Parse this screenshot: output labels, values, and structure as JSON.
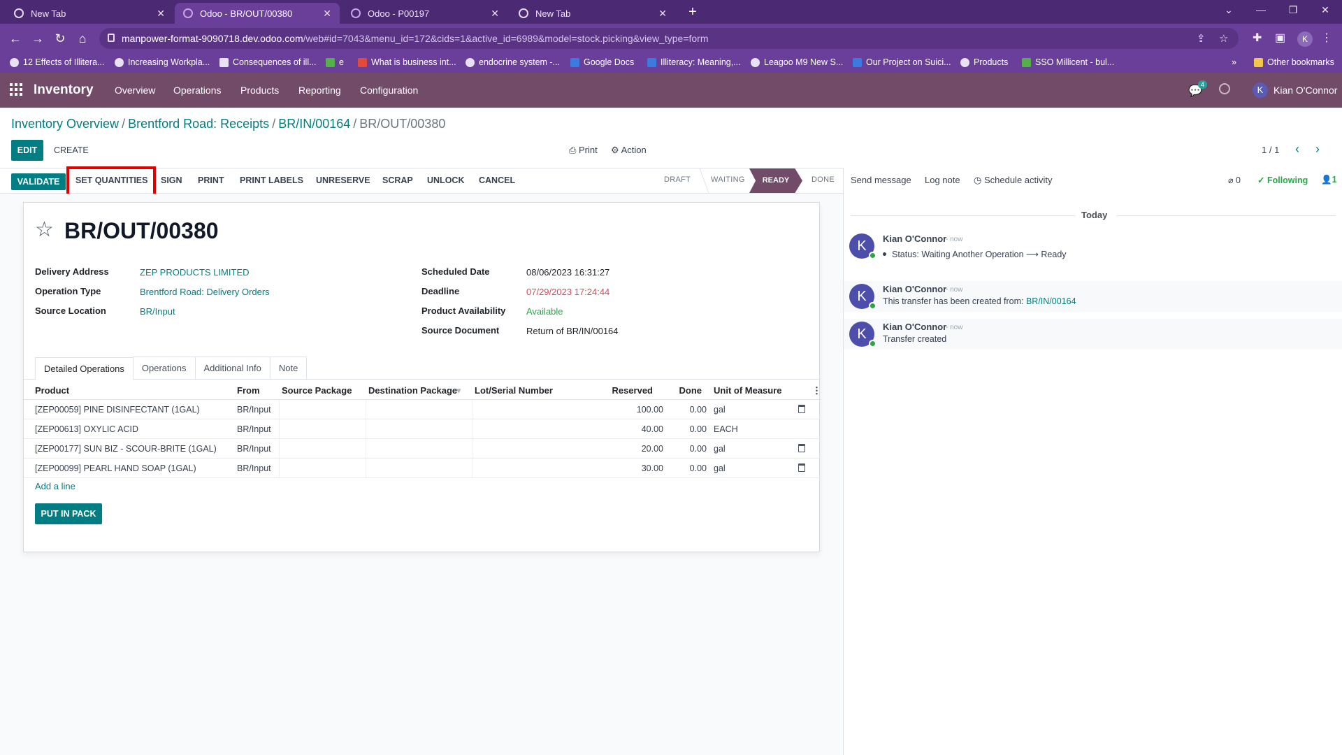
{
  "browser": {
    "tabs": [
      {
        "title": "New Tab",
        "active": false
      },
      {
        "title": "Odoo - BR/OUT/00380",
        "active": true
      },
      {
        "title": "Odoo - P00197",
        "active": false
      },
      {
        "title": "New Tab",
        "active": false
      }
    ],
    "url_host": "manpower-format-9090718.dev.odoo.com",
    "url_path": "/web#id=7043&menu_id=172&cids=1&active_id=6989&model=stock.picking&view_type=form",
    "bookmarks": [
      {
        "label": "12 Effects of Illitera...",
        "icon": "globe-icon"
      },
      {
        "label": "Increasing Workpla...",
        "icon": "globe-icon"
      },
      {
        "label": "Consequences of ill...",
        "icon": "site-icon"
      },
      {
        "label": "e",
        "icon": "drive-icon"
      },
      {
        "label": "What is business int...",
        "icon": "site-icon"
      },
      {
        "label": "endocrine system -...",
        "icon": "google-icon"
      },
      {
        "label": "Google Docs",
        "icon": "docs-icon"
      },
      {
        "label": "Illiteracy: Meaning,...",
        "icon": "site-icon"
      },
      {
        "label": "Leagoo M9 New S...",
        "icon": "globe-icon"
      },
      {
        "label": "Our Project on Suici...",
        "icon": "docs-icon"
      },
      {
        "label": "Products",
        "icon": "globe-icon"
      },
      {
        "label": "SSO Millicent - bul...",
        "icon": "sheets-icon"
      }
    ],
    "other_bookmarks": "Other bookmarks",
    "overflow": "»",
    "profile_initial": "K"
  },
  "navbar": {
    "app": "Inventory",
    "menus": [
      "Overview",
      "Operations",
      "Products",
      "Reporting",
      "Configuration"
    ],
    "chat_count": "4",
    "user": "Kian O'Connor",
    "user_initial": "K"
  },
  "breadcrumb": {
    "items": [
      "Inventory Overview",
      "Brentford Road: Receipts",
      "BR/IN/00164"
    ],
    "current": "BR/OUT/00380",
    "sep": "/"
  },
  "control": {
    "edit": "EDIT",
    "create": "CREATE",
    "print": "Print",
    "action": "Action",
    "pager": "1 / 1"
  },
  "statusbar": {
    "buttons": [
      "VALIDATE",
      "SET QUANTITIES",
      "SIGN",
      "PRINT",
      "PRINT LABELS",
      "UNRESERVE",
      "SCRAP",
      "UNLOCK",
      "CANCEL"
    ],
    "stages": [
      "DRAFT",
      "WAITING",
      "READY",
      "DONE"
    ],
    "current_stage": "READY"
  },
  "record": {
    "title": "BR/OUT/00380",
    "left_fields": [
      {
        "label": "Delivery Address",
        "value": "ZEP PRODUCTS LIMITED"
      },
      {
        "label": "Operation Type",
        "value": "Brentford Road: Delivery Orders"
      },
      {
        "label": "Source Location",
        "value": "BR/Input"
      }
    ],
    "right_fields": [
      {
        "label": "Scheduled Date",
        "value": "08/06/2023 16:31:27"
      },
      {
        "label": "Deadline",
        "value": "07/29/2023 17:24:44"
      },
      {
        "label": "Product Availability",
        "value": "Available"
      },
      {
        "label": "Source Document",
        "value": "Return of BR/IN/00164"
      }
    ]
  },
  "notebook": {
    "tabs": [
      "Detailed Operations",
      "Operations",
      "Additional Info",
      "Note"
    ],
    "active": "Detailed Operations"
  },
  "grid": {
    "columns": [
      "Product",
      "From",
      "Source Package",
      "Destination Package",
      "Lot/Serial Number",
      "Reserved",
      "Done",
      "Unit of Measure"
    ],
    "rows": [
      {
        "product": "[ZEP00059] PINE DISINFECTANT (1GAL)",
        "from": "BR/Input",
        "reserved": "100.00",
        "done": "0.00",
        "uom": "gal"
      },
      {
        "product": "[ZEP00613] OXYLIC ACID",
        "from": "BR/Input",
        "reserved": "40.00",
        "done": "0.00",
        "uom": "EACH"
      },
      {
        "product": "[ZEP00177] SUN BIZ - SCOUR-BRITE (1GAL)",
        "from": "BR/Input",
        "reserved": "20.00",
        "done": "0.00",
        "uom": "gal"
      },
      {
        "product": "[ZEP00099] PEARL HAND SOAP (1GAL)",
        "from": "BR/Input",
        "reserved": "30.00",
        "done": "0.00",
        "uom": "gal"
      }
    ],
    "add_line": "Add a line",
    "put_in_pack": "PUT IN PACK"
  },
  "chatter": {
    "send_message": "Send message",
    "log_note": "Log note",
    "schedule_activity": "Schedule activity",
    "attachments": "0",
    "following": "Following",
    "followers": "1",
    "today": "Today",
    "messages": [
      {
        "author": "Kian O'Connor",
        "time": "- now",
        "body": "Status: Waiting Another Operation ⟶ Ready",
        "bullet": true
      },
      {
        "author": "Kian O'Connor",
        "time": "- now",
        "body": "This transfer has been created from: ",
        "link": "BR/IN/00164"
      },
      {
        "author": "Kian O'Connor",
        "time": "- now",
        "body": "Transfer created"
      }
    ],
    "avatar_initial": "K"
  },
  "colors": {
    "brand": "#714b67",
    "accent": "#017e84",
    "browser": "#6a3f99",
    "highlight": "#e00000"
  }
}
